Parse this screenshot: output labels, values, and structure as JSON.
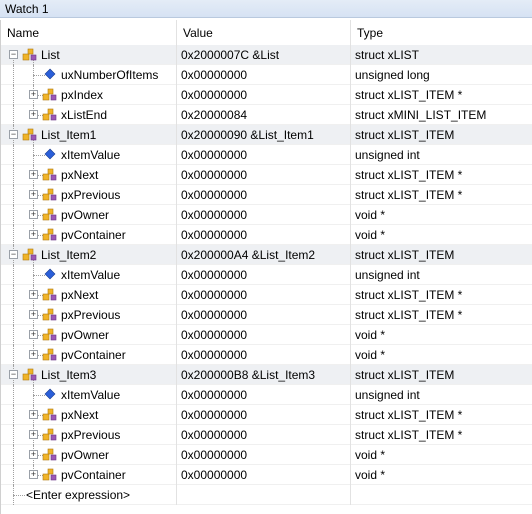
{
  "window": {
    "title": "Watch 1"
  },
  "columns": {
    "name": "Name",
    "value": "Value",
    "type": "Type"
  },
  "rows": [
    {
      "level": 0,
      "expander": "-",
      "icon": "struct",
      "name": "List",
      "value": "0x2000007C &List",
      "type": "struct xLIST"
    },
    {
      "level": 1,
      "expander": "",
      "icon": "field",
      "name": "uxNumberOfItems",
      "value": "0x00000000",
      "type": "unsigned long"
    },
    {
      "level": 1,
      "expander": "+",
      "icon": "struct",
      "name": "pxIndex",
      "value": "0x00000000",
      "type": "struct xLIST_ITEM *"
    },
    {
      "level": 1,
      "expander": "+",
      "icon": "struct",
      "name": "xListEnd",
      "value": "0x20000084",
      "type": "struct xMINI_LIST_ITEM"
    },
    {
      "level": 0,
      "expander": "-",
      "icon": "struct",
      "name": "List_Item1",
      "value": "0x20000090 &List_Item1",
      "type": "struct xLIST_ITEM"
    },
    {
      "level": 1,
      "expander": "",
      "icon": "field",
      "name": "xItemValue",
      "value": "0x00000000",
      "type": "unsigned int"
    },
    {
      "level": 1,
      "expander": "+",
      "icon": "struct",
      "name": "pxNext",
      "value": "0x00000000",
      "type": "struct xLIST_ITEM *"
    },
    {
      "level": 1,
      "expander": "+",
      "icon": "struct",
      "name": "pxPrevious",
      "value": "0x00000000",
      "type": "struct xLIST_ITEM *"
    },
    {
      "level": 1,
      "expander": "+",
      "icon": "struct",
      "name": "pvOwner",
      "value": "0x00000000",
      "type": "void *"
    },
    {
      "level": 1,
      "expander": "+",
      "icon": "struct",
      "name": "pvContainer",
      "value": "0x00000000",
      "type": "void *"
    },
    {
      "level": 0,
      "expander": "-",
      "icon": "struct",
      "name": "List_Item2",
      "value": "0x200000A4 &List_Item2",
      "type": "struct xLIST_ITEM"
    },
    {
      "level": 1,
      "expander": "",
      "icon": "field",
      "name": "xItemValue",
      "value": "0x00000000",
      "type": "unsigned int"
    },
    {
      "level": 1,
      "expander": "+",
      "icon": "struct",
      "name": "pxNext",
      "value": "0x00000000",
      "type": "struct xLIST_ITEM *"
    },
    {
      "level": 1,
      "expander": "+",
      "icon": "struct",
      "name": "pxPrevious",
      "value": "0x00000000",
      "type": "struct xLIST_ITEM *"
    },
    {
      "level": 1,
      "expander": "+",
      "icon": "struct",
      "name": "pvOwner",
      "value": "0x00000000",
      "type": "void *"
    },
    {
      "level": 1,
      "expander": "+",
      "icon": "struct",
      "name": "pvContainer",
      "value": "0x00000000",
      "type": "void *"
    },
    {
      "level": 0,
      "expander": "-",
      "icon": "struct",
      "name": "List_Item3",
      "value": "0x200000B8 &List_Item3",
      "type": "struct xLIST_ITEM"
    },
    {
      "level": 1,
      "expander": "",
      "icon": "field",
      "name": "xItemValue",
      "value": "0x00000000",
      "type": "unsigned int"
    },
    {
      "level": 1,
      "expander": "+",
      "icon": "struct",
      "name": "pxNext",
      "value": "0x00000000",
      "type": "struct xLIST_ITEM *"
    },
    {
      "level": 1,
      "expander": "+",
      "icon": "struct",
      "name": "pxPrevious",
      "value": "0x00000000",
      "type": "struct xLIST_ITEM *"
    },
    {
      "level": 1,
      "expander": "+",
      "icon": "struct",
      "name": "pvOwner",
      "value": "0x00000000",
      "type": "void *"
    },
    {
      "level": 1,
      "expander": "+",
      "icon": "struct",
      "name": "pvContainer",
      "value": "0x00000000",
      "type": "void *"
    },
    {
      "level": 0,
      "expander": "",
      "icon": "none",
      "name": "<Enter expression>",
      "value": "",
      "type": ""
    }
  ],
  "colors": {
    "struct_icon_yellow": "#f0b428",
    "struct_icon_purple": "#9b59b6",
    "field_icon_blue": "#2b5fd9",
    "row_highlight": "#eef0f3"
  }
}
